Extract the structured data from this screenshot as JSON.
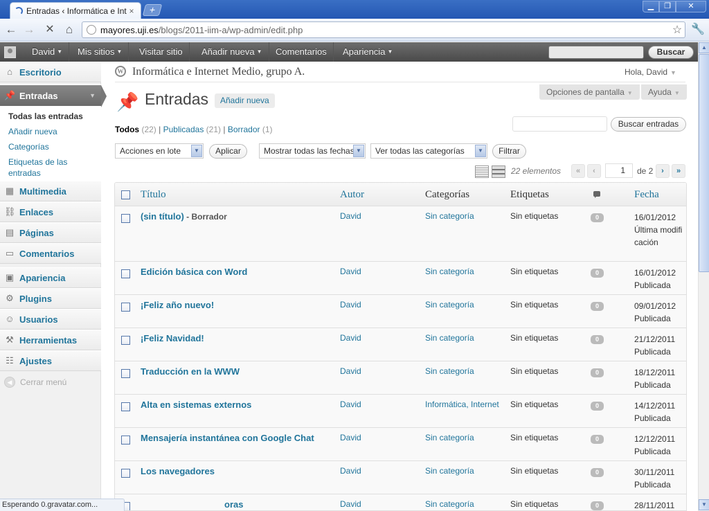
{
  "browser": {
    "tab_title": "Entradas ‹ Informática e Internet Medio, grupo A. — WordPress",
    "tab_close": "×",
    "new_tab": "+",
    "url_host": "mayores.uji.es",
    "url_path": "/blogs/2011-iim-a/wp-admin/edit.php",
    "status_text": "Esperando 0.gravatar.com..."
  },
  "admin_bar": {
    "user": "David",
    "my_sites": "Mis sitios",
    "visit_site": "Visitar sitio",
    "add_new": "Añadir nueva",
    "comments": "Comentarios",
    "appearance": "Apariencia",
    "search_button": "Buscar"
  },
  "menu": {
    "items": [
      {
        "label": "Escritorio",
        "icon": "dashboard-icon"
      },
      {
        "label": "Entradas",
        "icon": "pushpin-icon"
      },
      {
        "label": "Multimedia",
        "icon": "media-icon"
      },
      {
        "label": "Enlaces",
        "icon": "links-icon"
      },
      {
        "label": "Páginas",
        "icon": "pages-icon"
      },
      {
        "label": "Comentarios",
        "icon": "comments-icon"
      },
      {
        "label": "Apariencia",
        "icon": "appearance-icon"
      },
      {
        "label": "Plugins",
        "icon": "plugins-icon"
      },
      {
        "label": "Usuarios",
        "icon": "users-icon"
      },
      {
        "label": "Herramientas",
        "icon": "tools-icon"
      },
      {
        "label": "Ajustes",
        "icon": "settings-icon"
      }
    ],
    "submenu": [
      "Todas las entradas",
      "Añadir nueva",
      "Categorías",
      "Etiquetas de las entradas"
    ],
    "collapse": "Cerrar menú"
  },
  "header": {
    "site_title": "Informática e Internet Medio, grupo A.",
    "greeting": "Hola, David",
    "screen_options": "Opciones de pantalla",
    "help": "Ayuda",
    "page_title": "Entradas",
    "add_new": "Añadir nueva"
  },
  "filters": {
    "all_label": "Todos",
    "all_count": "(22)",
    "published_label": "Publicadas",
    "published_count": "(21)",
    "draft_label": "Borrador",
    "draft_count": "(1)",
    "separator": "|",
    "bulk_actions": "Acciones en lote",
    "apply": "Aplicar",
    "dates": "Mostrar todas las fechas",
    "categories": "Ver todas las categorías",
    "filter": "Filtrar",
    "search_button": "Buscar entradas"
  },
  "pagination": {
    "items": "22 elementos",
    "first": "«",
    "prev": "‹",
    "current": "1",
    "of_total": "de 2",
    "next": "›",
    "last": "»"
  },
  "table": {
    "columns": {
      "title": "Título",
      "author": "Autor",
      "categories": "Categorías",
      "tags": "Etiquetas",
      "date": "Fecha"
    },
    "rows": [
      {
        "title": "(sin título)",
        "state": " - Borrador",
        "author": "David",
        "category": "Sin categoría",
        "tags": "Sin etiquetas",
        "comments": "0",
        "date": "16/01/2012",
        "status": "Última modificación"
      },
      {
        "title": "Edición básica con Word",
        "state": "",
        "author": "David",
        "category": "Sin categoría",
        "tags": "Sin etiquetas",
        "comments": "0",
        "date": "16/01/2012",
        "status": "Publicada"
      },
      {
        "title": "¡Feliz año nuevo!",
        "state": "",
        "author": "David",
        "category": "Sin categoría",
        "tags": "Sin etiquetas",
        "comments": "0",
        "date": "09/01/2012",
        "status": "Publicada"
      },
      {
        "title": "¡Feliz Navidad!",
        "state": "",
        "author": "David",
        "category": "Sin categoría",
        "tags": "Sin etiquetas",
        "comments": "0",
        "date": "21/12/2011",
        "status": "Publicada"
      },
      {
        "title": "Traducción en la WWW",
        "state": "",
        "author": "David",
        "category": "Sin categoría",
        "tags": "Sin etiquetas",
        "comments": "0",
        "date": "18/12/2011",
        "status": "Publicada"
      },
      {
        "title": "Alta en sistemas externos",
        "state": "",
        "author": "David",
        "category": "Informática, Internet",
        "tags": "Sin etiquetas",
        "comments": "0",
        "date": "14/12/2011",
        "status": "Publicada"
      },
      {
        "title": "Mensajería instantánea con Google Chat",
        "state": "",
        "author": "David",
        "category": "Sin categoría",
        "tags": "Sin etiquetas",
        "comments": "0",
        "date": "12/12/2011",
        "status": "Publicada"
      },
      {
        "title": "Los navegadores",
        "state": "",
        "author": "David",
        "category": "Sin categoría",
        "tags": "Sin etiquetas",
        "comments": "0",
        "date": "30/11/2011",
        "status": "Publicada"
      },
      {
        "title": "oras",
        "state": "",
        "author": "David",
        "category": "Sin categoría",
        "tags": "Sin etiquetas",
        "comments": "0",
        "date": "28/11/2011",
        "status": ""
      }
    ]
  }
}
